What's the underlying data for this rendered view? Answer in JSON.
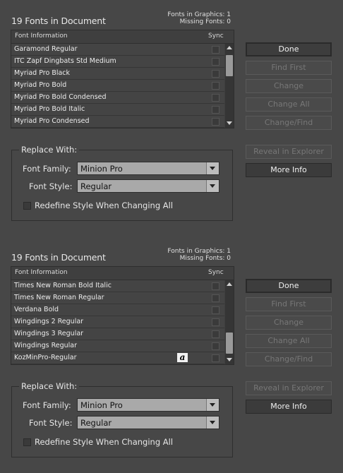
{
  "panels": [
    {
      "title": "19 Fonts in Document",
      "fonts_in_graphics": "Fonts in Graphics: 1",
      "missing_fonts": "Missing Fonts: 0",
      "header": {
        "info": "Font Information",
        "sync": "Sync"
      },
      "rows": [
        {
          "name": "Garamond Regular"
        },
        {
          "name": "ITC Zapf Dingbats Std Medium"
        },
        {
          "name": "Myriad Pro Black"
        },
        {
          "name": "Myriad Pro Bold"
        },
        {
          "name": "Myriad Pro Bold Condensed"
        },
        {
          "name": "Myriad Pro Bold Italic"
        },
        {
          "name": "Myriad Pro Condensed"
        }
      ],
      "buttons": {
        "done": "Done",
        "find_first": "Find First",
        "change": "Change",
        "change_all": "Change All",
        "change_find": "Change/Find",
        "reveal": "Reveal in Explorer",
        "more_info": "More Info"
      },
      "replace": {
        "title": "Replace With:",
        "family_label": "Font Family:",
        "family_value": "Minion Pro",
        "style_label": "Font Style:",
        "style_value": "Regular",
        "redefine_label": "Redefine Style When Changing All"
      }
    },
    {
      "title": "19 Fonts in Document",
      "fonts_in_graphics": "Fonts in Graphics: 1",
      "missing_fonts": "Missing Fonts: 0",
      "header": {
        "info": "Font Information",
        "sync": "Sync"
      },
      "rows": [
        {
          "name": "Times New Roman Bold Italic"
        },
        {
          "name": "Times New Roman Regular"
        },
        {
          "name": "Verdana Bold"
        },
        {
          "name": "Wingdings 2 Regular"
        },
        {
          "name": "Wingdings 3 Regular"
        },
        {
          "name": "Wingdings Regular"
        },
        {
          "name": "KozMinPro-Regular",
          "glyph": "a"
        }
      ],
      "buttons": {
        "done": "Done",
        "find_first": "Find First",
        "change": "Change",
        "change_all": "Change All",
        "change_find": "Change/Find",
        "reveal": "Reveal in Explorer",
        "more_info": "More Info"
      },
      "replace": {
        "title": "Replace With:",
        "family_label": "Font Family:",
        "family_value": "Minion Pro",
        "style_label": "Font Style:",
        "style_value": "Regular",
        "redefine_label": "Redefine Style When Changing All"
      }
    }
  ],
  "scroll_positions": [
    0.0,
    1.0
  ]
}
